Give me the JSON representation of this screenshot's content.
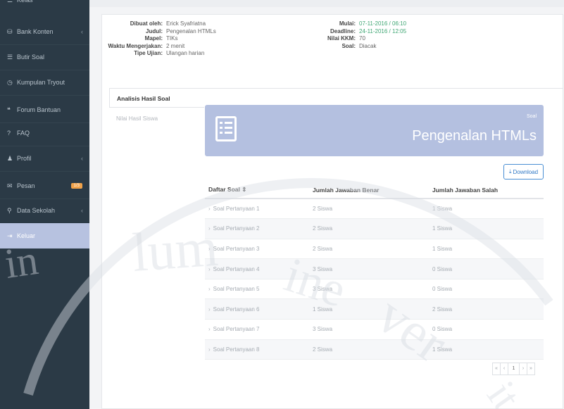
{
  "sidebar": {
    "items": [
      {
        "icon": "list-icon",
        "glyph": "☰",
        "label": "Kelas"
      },
      {
        "icon": "database-icon",
        "glyph": "⛁",
        "label": "Bank Konten",
        "chevron": "‹"
      },
      {
        "icon": "list-icon",
        "glyph": "☰",
        "label": "Butir Soal"
      },
      {
        "icon": "clock-icon",
        "glyph": "◷",
        "label": "Kumpulan Tryout"
      },
      {
        "icon": "chat-icon",
        "glyph": "❝",
        "label": "Forum Bantuan"
      },
      {
        "icon": "question-icon",
        "glyph": "?",
        "label": "FAQ"
      },
      {
        "icon": "user-icon",
        "glyph": "♟",
        "label": "Profil",
        "chevron": "‹"
      },
      {
        "icon": "mail-icon",
        "glyph": "✉",
        "label": "Pesan",
        "badge": "1/3"
      },
      {
        "icon": "search-icon",
        "glyph": "⚲",
        "label": "Data Sekolah",
        "chevron": "‹"
      },
      {
        "icon": "logout-icon",
        "glyph": "⇥",
        "label": "Keluar",
        "active": true
      }
    ]
  },
  "info_left": [
    {
      "label": "Dibuat oleh:",
      "value": "Erick Syafriatna"
    },
    {
      "label": "Judul:",
      "value": "Pengenalan HTMLs"
    },
    {
      "label": "Mapel:",
      "value": "TIKs"
    },
    {
      "label": "Waktu Mengerjakan:",
      "value": "2 menit"
    },
    {
      "label": "Tipe Ujian:",
      "value": "Ulangan harian"
    }
  ],
  "info_right": [
    {
      "label": "Mulai:",
      "value": "07-11-2016 / 06:10",
      "color": "green"
    },
    {
      "label": "Deadline:",
      "value": "24-11-2016 / 12:05",
      "color": "green"
    },
    {
      "label": "Nilai KKM:",
      "value": "70"
    },
    {
      "label": "Soal:",
      "value": "Diacak"
    }
  ],
  "tabs": {
    "active": "Analisis Hasil Soal",
    "inactive": "Nilai Hasil Siswa"
  },
  "hero": {
    "subtitle": "Soal",
    "title": "Pengenalan HTMLs"
  },
  "download_label": "Download",
  "table": {
    "headers": [
      "Daftar Soal ⇕",
      "Jumlah Jawaban Benar",
      "Jumlah Jawaban Salah"
    ],
    "rows": [
      [
        "Soal Pertanyaan 1",
        "2 Siswa",
        "1 Siswa"
      ],
      [
        "Soal Pertanyaan 2",
        "2 Siswa",
        "1 Siswa"
      ],
      [
        "Soal Pertanyaan 3",
        "2 Siswa",
        "1 Siswa"
      ],
      [
        "Soal Pertanyaan 4",
        "3 Siswa",
        "0 Siswa"
      ],
      [
        "Soal Pertanyaan 5",
        "3 Siswa",
        "0 Siswa"
      ],
      [
        "Soal Pertanyaan 6",
        "1 Siswa",
        "2 Siswa"
      ],
      [
        "Soal Pertanyaan 7",
        "3 Siswa",
        "0 Siswa"
      ],
      [
        "Soal Pertanyaan 8",
        "2 Siswa",
        "1 Siswa"
      ]
    ]
  },
  "pagination": {
    "first": "«",
    "prev": "‹",
    "current": "1",
    "next": "›",
    "last": "»"
  },
  "watermark": "lumine verit",
  "colors": {
    "sidebar_bg": "#2b3a46",
    "active_item": "#b7c2e0",
    "hero_bg": "#b4c0e0",
    "badge": "#f0a24a",
    "date_green": "#3ea673",
    "download_blue": "#2f78c5"
  }
}
